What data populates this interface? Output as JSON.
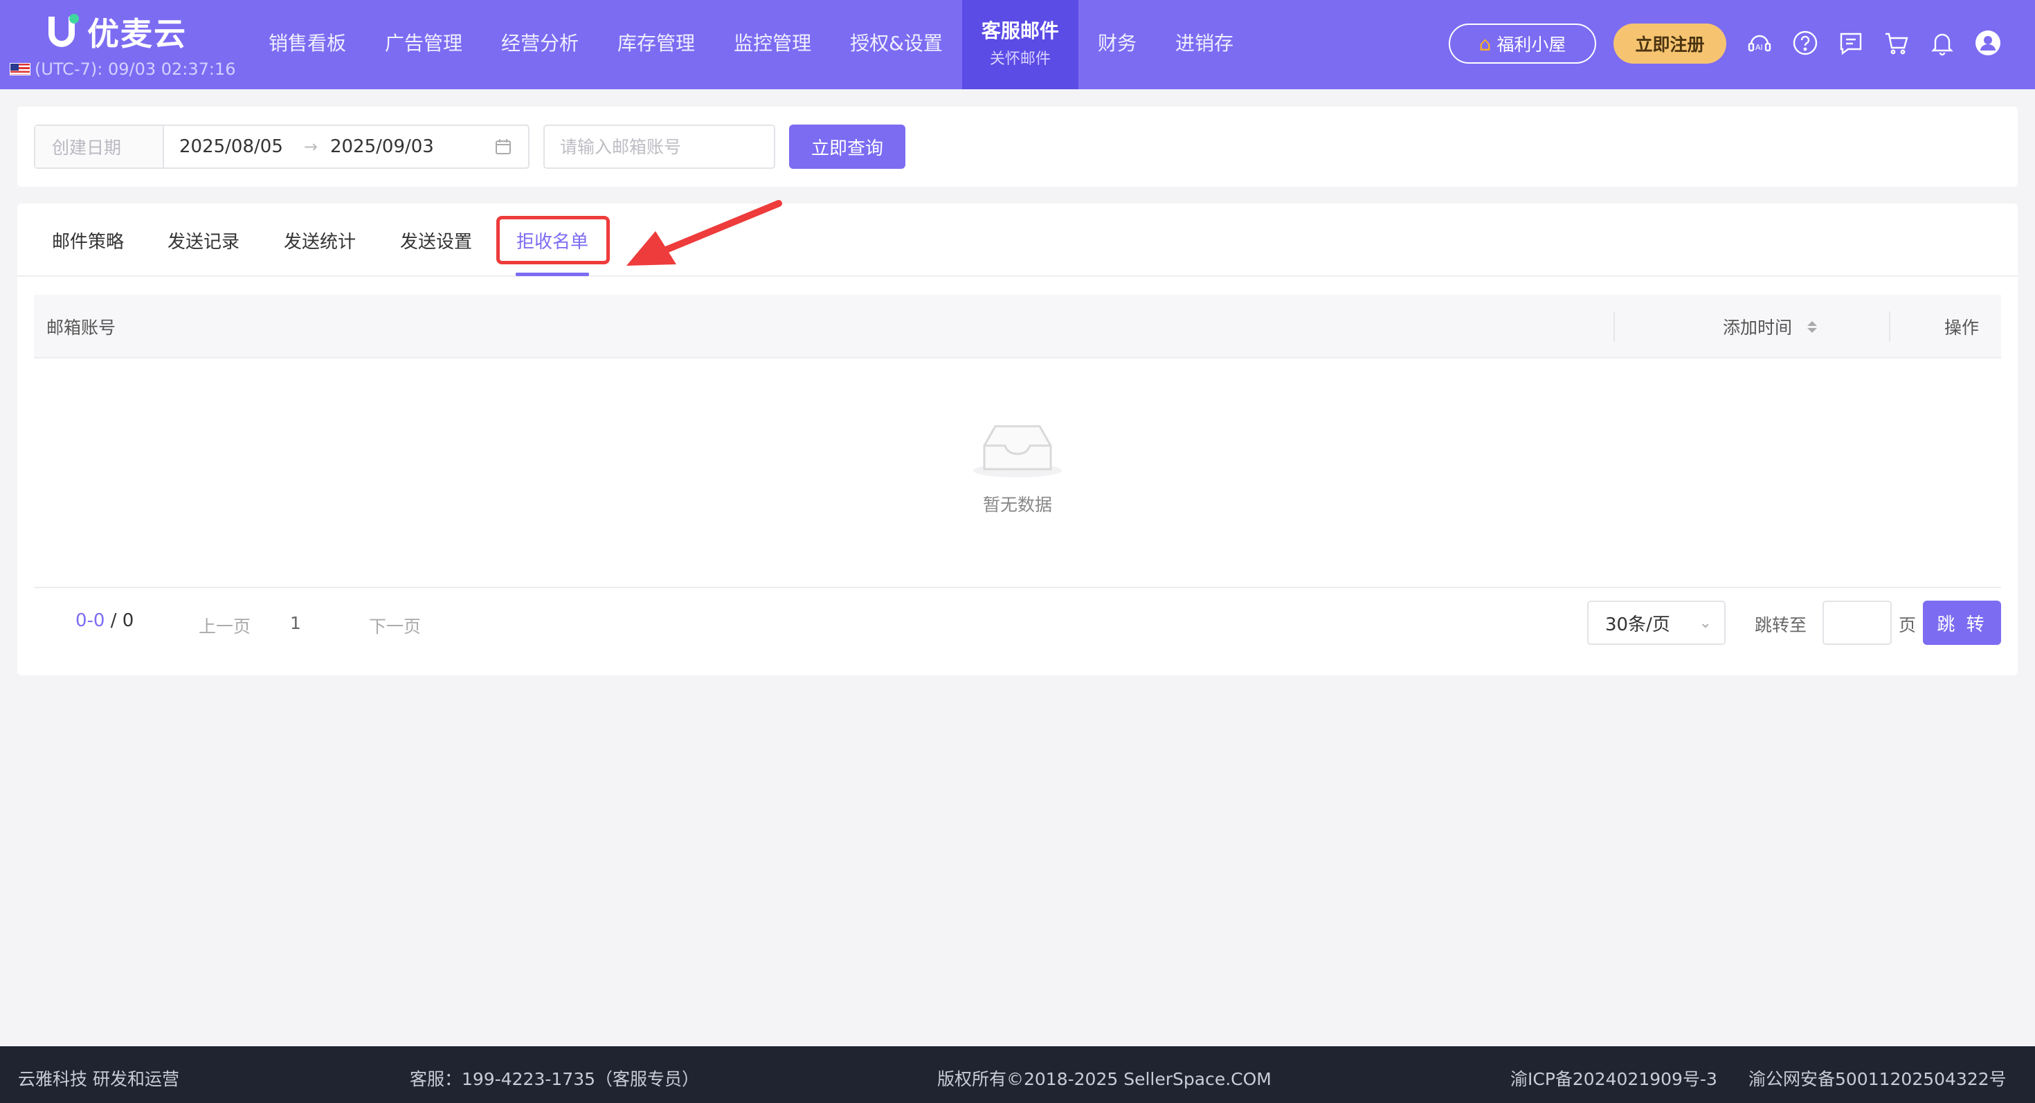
{
  "header": {
    "brand": "优麦云",
    "clock": "(UTC-7): 09/03 02:37:16",
    "nav": [
      {
        "label": "销售看板",
        "sub": ""
      },
      {
        "label": "广告管理",
        "sub": ""
      },
      {
        "label": "经营分析",
        "sub": ""
      },
      {
        "label": "库存管理",
        "sub": ""
      },
      {
        "label": "监控管理",
        "sub": ""
      },
      {
        "label": "授权&设置",
        "sub": ""
      },
      {
        "label": "客服邮件",
        "sub": "关怀邮件"
      },
      {
        "label": "财务",
        "sub": ""
      },
      {
        "label": "进销存",
        "sub": ""
      }
    ],
    "welfare_label": "福利小屋",
    "register_label": "立即注册",
    "icons": [
      "ai-assistant-icon",
      "help-icon",
      "message-icon",
      "cart-icon",
      "bell-icon",
      "user-avatar-icon"
    ]
  },
  "filter": {
    "date_label": "创建日期",
    "date_start": "2025/08/05",
    "date_end": "2025/09/03",
    "email_placeholder": "请输入邮箱账号",
    "query_label": "立即查询"
  },
  "tabs": [
    {
      "label": "邮件策略"
    },
    {
      "label": "发送记录"
    },
    {
      "label": "发送统计"
    },
    {
      "label": "发送设置"
    },
    {
      "label": "拒收名单",
      "active": true
    }
  ],
  "table": {
    "columns": [
      "邮箱账号",
      "添加时间",
      "操作"
    ],
    "rows": [],
    "empty_text": "暂无数据"
  },
  "pagination": {
    "range": "0-0",
    "total": "/ 0",
    "prev": "上一页",
    "current": "1",
    "next": "下一页",
    "page_size": "30条/页",
    "jump_label": "跳转至",
    "page_unit": "页",
    "jump_button": "跳 转"
  },
  "footer": {
    "company": "云雅科技 研发和运营",
    "service": "客服：199-4223-1735（客服专员）",
    "copyright": "版权所有©2018-2025 SellerSpace.COM",
    "icp": "渝ICP备2024021909号-3",
    "police": "渝公网安备50011202504322号"
  },
  "colors": {
    "primary": "#7c6cf2",
    "nav_active": "#5b4ce6",
    "highlight": "#ee3b3b",
    "register": "#f6c471",
    "footer": "#1f2430"
  }
}
